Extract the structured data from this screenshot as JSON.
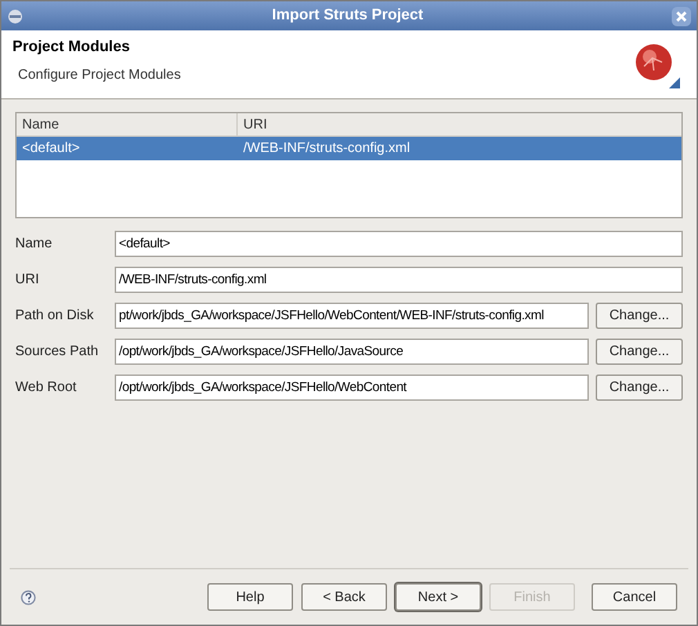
{
  "window": {
    "title": "Import Struts Project"
  },
  "header": {
    "title": "Project Modules",
    "subtitle": "Configure Project Modules"
  },
  "table": {
    "columns": [
      "Name",
      "URI"
    ],
    "rows": [
      {
        "cells": [
          "<default>",
          "/WEB-INF/struts-config.xml"
        ],
        "selected": true
      }
    ]
  },
  "fields": [
    {
      "label": "Name",
      "value": "<default>"
    },
    {
      "label": "URI",
      "value": "/WEB-INF/struts-config.xml"
    },
    {
      "label": "Path on Disk",
      "value": "pt/work/jbds_GA/workspace/JSFHello/WebContent/WEB-INF/struts-config.xml",
      "button": "Change..."
    },
    {
      "label": "Sources Path",
      "value": "/opt/work/jbds_GA/workspace/JSFHello/JavaSource",
      "button": "Change..."
    },
    {
      "label": "Web Root",
      "value": "/opt/work/jbds_GA/workspace/JSFHello/WebContent",
      "button": "Change..."
    }
  ],
  "buttons": [
    {
      "label": "Help",
      "disabled": false,
      "default": false
    },
    {
      "label": "< Back",
      "disabled": false,
      "default": false
    },
    {
      "label": "Next >",
      "disabled": false,
      "default": true
    },
    {
      "label": "Finish",
      "disabled": true,
      "default": false
    },
    {
      "label": "Cancel",
      "disabled": false,
      "default": false
    }
  ]
}
